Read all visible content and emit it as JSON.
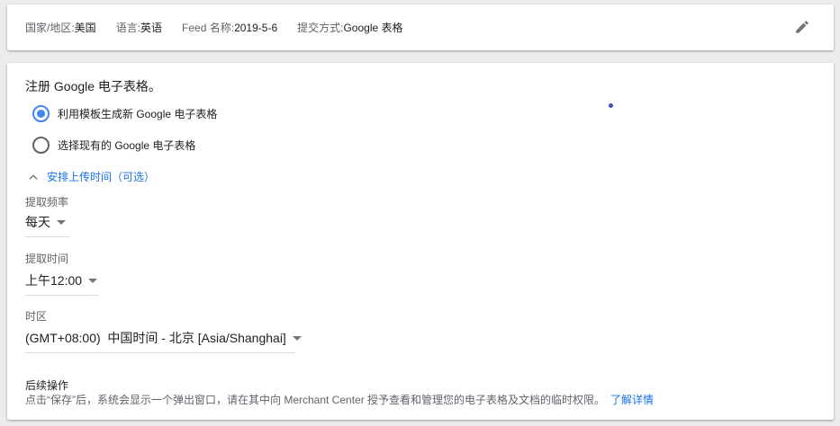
{
  "summary": {
    "country_key": "国家/地区:",
    "country_val": "美国",
    "language_key": "语言:",
    "language_val": "英语",
    "feed_key": "Feed 名称:",
    "feed_val": "2019-5-6",
    "method_key": "提交方式:",
    "method_val": "Google 表格"
  },
  "form": {
    "title": "注册 Google 电子表格。",
    "options": [
      {
        "label": "利用模板生成新 Google 电子表格",
        "checked": true
      },
      {
        "label": "选择现有的 Google 电子表格",
        "checked": false
      }
    ],
    "schedule_toggle": "安排上传时间（可选）",
    "frequency": {
      "label": "提取频率",
      "value": "每天"
    },
    "time": {
      "label": "提取时间",
      "value": "上午12:00"
    },
    "timezone": {
      "label": "时区",
      "value": "(GMT+08:00)  中国时间 - 北京 [Asia/Shanghai]"
    },
    "followup": {
      "title": "后续操作",
      "description": "点击“保存”后，系统会显示一个弹出窗口，请在其中向 Merchant Center 授予查看和管理您的电子表格及文档的临时权限。",
      "link": "了解详情"
    }
  },
  "icons": {
    "edit": "edit-pencil-icon",
    "chevron": "chevron-up-icon"
  },
  "colors": {
    "accent": "#4285f4",
    "link": "#1a73e8",
    "background": "#ececec"
  }
}
